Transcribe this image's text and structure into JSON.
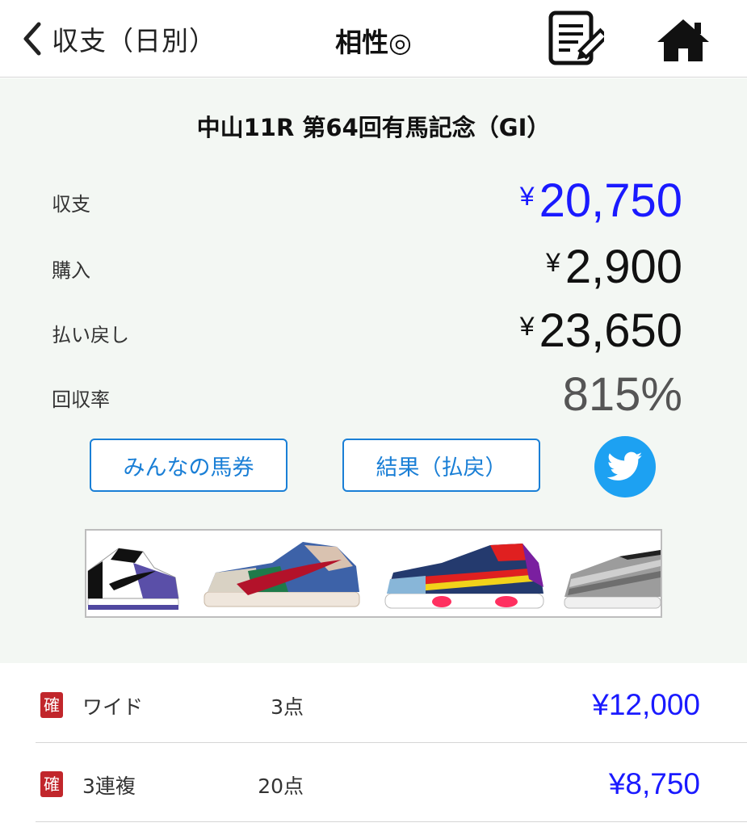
{
  "nav": {
    "back_label": "収支（日別）",
    "title": "相性◎"
  },
  "summary": {
    "race_title": "中山11R  第64回有馬記念（GI）",
    "balance_label": "収支",
    "balance_yen": "¥",
    "balance_value": "20,750",
    "purchase_label": "購入",
    "purchase_yen": "¥",
    "purchase_value": "2,900",
    "payout_label": "払い戻し",
    "payout_yen": "¥",
    "payout_value": "23,650",
    "recovery_label": "回収率",
    "recovery_value": "815%"
  },
  "buttons": {
    "everyone_label": "みんなの馬券",
    "result_label": "結果（払戻）"
  },
  "bets": [
    {
      "mark": "確",
      "type": "ワイド",
      "points": "3点",
      "amount": "¥12,000"
    },
    {
      "mark": "確",
      "type": "3連複",
      "points": "20点",
      "amount": "¥8,750"
    }
  ],
  "colors": {
    "positive": "#1a1aff",
    "link": "#1a7fd6",
    "twitter": "#1da1f2",
    "confirmed_badge": "#c1262b",
    "summary_bg": "#f3f7f3"
  },
  "icons": [
    "chevron-left-icon",
    "memo-edit-icon",
    "home-icon",
    "twitter-bird-icon"
  ]
}
